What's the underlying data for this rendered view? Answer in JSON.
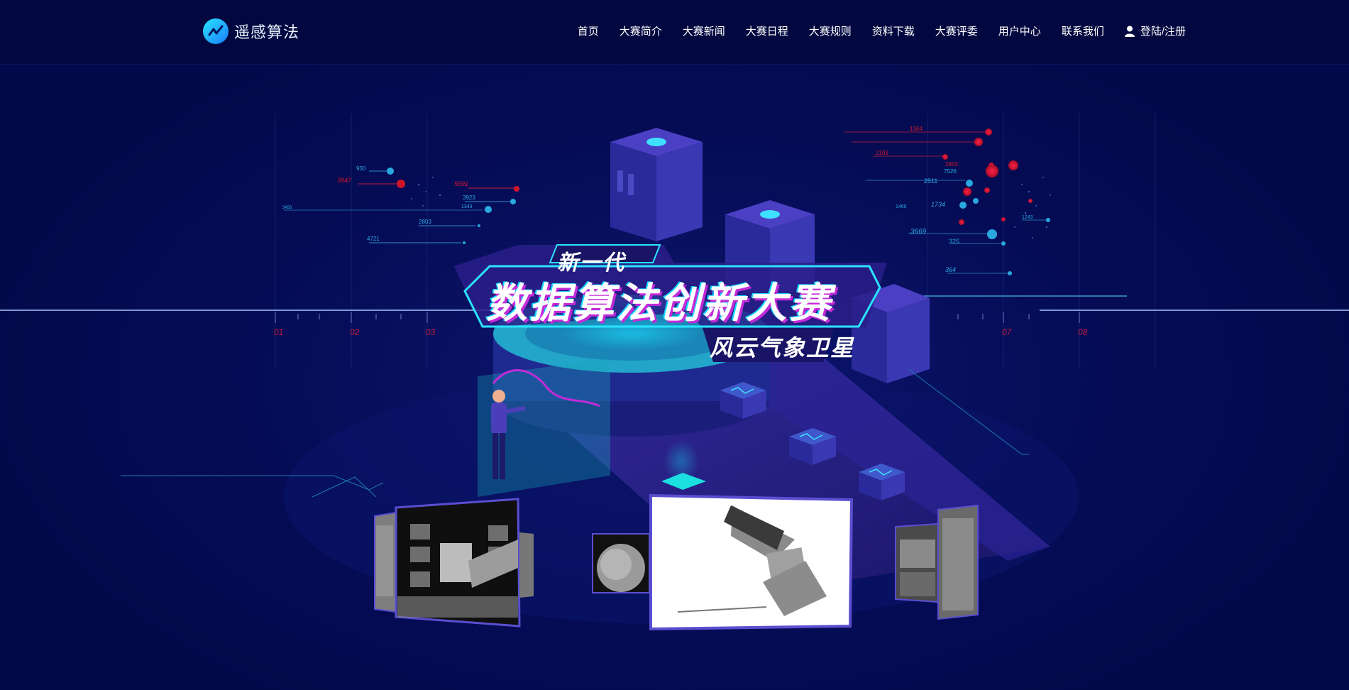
{
  "header": {
    "logo_text": "遥感算法",
    "nav": [
      {
        "label": "首页"
      },
      {
        "label": "大赛简介"
      },
      {
        "label": "大赛新闻"
      },
      {
        "label": "大赛日程"
      },
      {
        "label": "大赛规则"
      },
      {
        "label": "资料下载"
      },
      {
        "label": "大赛评委"
      },
      {
        "label": "用户中心"
      },
      {
        "label": "联系我们"
      }
    ],
    "login_label": "登陆/注册"
  },
  "hero": {
    "subtitle_top": "新一代",
    "title": "数据算法创新大赛",
    "subtitle_bottom": "风云气象卫星",
    "left_markers": [
      "930",
      "3947",
      "5691",
      "3923",
      "1343",
      "2803",
      "4721",
      "3456"
    ],
    "right_markers": [
      "1304",
      "2103",
      "2653",
      "7526",
      "2511",
      "1734",
      "1460",
      "3669",
      "325",
      "364",
      "1243"
    ],
    "axis_ticks": [
      "01",
      "02",
      "03",
      "07",
      "08"
    ]
  },
  "colors": {
    "background": "#03094a",
    "header": "#02083f",
    "accent_cyan": "#29e4ff",
    "accent_magenta": "#c22bd8",
    "accent_red": "#d0142a"
  }
}
